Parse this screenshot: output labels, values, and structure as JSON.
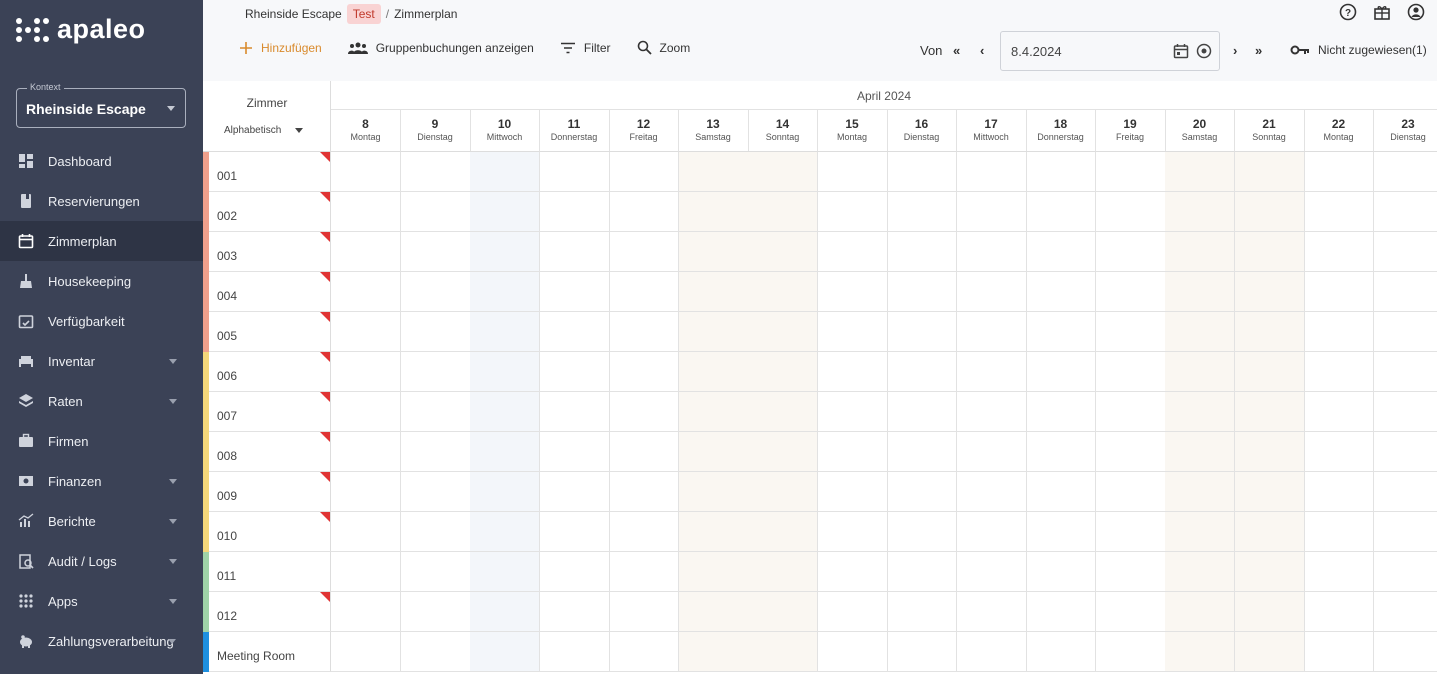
{
  "brand": {
    "name": "apaleo"
  },
  "context": {
    "legend": "Kontext",
    "value": "Rheinside Escape"
  },
  "nav": [
    {
      "label": "Dashboard",
      "icon": "dashboard-icon",
      "caret": false,
      "active": false
    },
    {
      "label": "Reservierungen",
      "icon": "book-icon",
      "caret": false,
      "active": false
    },
    {
      "label": "Zimmerplan",
      "icon": "calendar-icon",
      "caret": false,
      "active": true
    },
    {
      "label": "Housekeeping",
      "icon": "broom-icon",
      "caret": false,
      "active": false
    },
    {
      "label": "Verfügbarkeit",
      "icon": "calendar-check-icon",
      "caret": false,
      "active": false
    },
    {
      "label": "Inventar",
      "icon": "bed-icon",
      "caret": true,
      "active": false
    },
    {
      "label": "Raten",
      "icon": "layers-icon",
      "caret": true,
      "active": false
    },
    {
      "label": "Firmen",
      "icon": "briefcase-icon",
      "caret": false,
      "active": false
    },
    {
      "label": "Finanzen",
      "icon": "money-icon",
      "caret": true,
      "active": false
    },
    {
      "label": "Berichte",
      "icon": "chart-icon",
      "caret": true,
      "active": false
    },
    {
      "label": "Audit / Logs",
      "icon": "audit-icon",
      "caret": true,
      "active": false
    },
    {
      "label": "Apps",
      "icon": "apps-icon",
      "caret": true,
      "active": false
    },
    {
      "label": "Zahlungsverarbeitung",
      "icon": "piggy-bank-icon",
      "caret": true,
      "active": false
    }
  ],
  "breadcrumb": {
    "property": "Rheinside Escape",
    "badge": "Test",
    "separator": "/",
    "page": "Zimmerplan"
  },
  "toolbar": {
    "add": "Hinzufügen",
    "groups": "Gruppenbuchungen anzeigen",
    "filter": "Filter",
    "zoom": "Zoom",
    "from_label": "Von",
    "date": "8.4.2024",
    "unassigned": "Nicht zugewiesen(1)"
  },
  "colors": {
    "accent": "#d98a2c",
    "sidebar": "#3b4256",
    "flag": "#e03434"
  },
  "grid": {
    "room_header": "Zimmer",
    "sort": "Alphabetisch",
    "month": "April 2024",
    "days": [
      {
        "num": "8",
        "name": "Montag",
        "type": "normal"
      },
      {
        "num": "9",
        "name": "Dienstag",
        "type": "normal"
      },
      {
        "num": "10",
        "name": "Mittwoch",
        "type": "today"
      },
      {
        "num": "11",
        "name": "Donnerstag",
        "type": "normal"
      },
      {
        "num": "12",
        "name": "Freitag",
        "type": "normal"
      },
      {
        "num": "13",
        "name": "Samstag",
        "type": "weekend"
      },
      {
        "num": "14",
        "name": "Sonntag",
        "type": "weekend"
      },
      {
        "num": "15",
        "name": "Montag",
        "type": "normal"
      },
      {
        "num": "16",
        "name": "Dienstag",
        "type": "normal"
      },
      {
        "num": "17",
        "name": "Mittwoch",
        "type": "normal"
      },
      {
        "num": "18",
        "name": "Donnerstag",
        "type": "normal"
      },
      {
        "num": "19",
        "name": "Freitag",
        "type": "normal"
      },
      {
        "num": "20",
        "name": "Samstag",
        "type": "weekend"
      },
      {
        "num": "21",
        "name": "Sonntag",
        "type": "weekend"
      },
      {
        "num": "22",
        "name": "Montag",
        "type": "normal"
      },
      {
        "num": "23",
        "name": "Dienstag",
        "type": "normal"
      }
    ],
    "rooms": [
      {
        "name": "001",
        "color": "#f0a08c",
        "flag": true
      },
      {
        "name": "002",
        "color": "#f0a08c",
        "flag": true
      },
      {
        "name": "003",
        "color": "#f0a08c",
        "flag": true
      },
      {
        "name": "004",
        "color": "#f0a08c",
        "flag": true
      },
      {
        "name": "005",
        "color": "#f0a08c",
        "flag": true
      },
      {
        "name": "006",
        "color": "#f5d77a",
        "flag": true
      },
      {
        "name": "007",
        "color": "#f5d77a",
        "flag": true
      },
      {
        "name": "008",
        "color": "#f5d77a",
        "flag": true
      },
      {
        "name": "009",
        "color": "#f5d77a",
        "flag": true
      },
      {
        "name": "010",
        "color": "#f5d77a",
        "flag": true
      },
      {
        "name": "011",
        "color": "#9fd3a8",
        "flag": false
      },
      {
        "name": "012",
        "color": "#9fd3a8",
        "flag": true
      },
      {
        "name": "Meeting Room",
        "color": "#1e90e0",
        "flag": false
      }
    ]
  }
}
